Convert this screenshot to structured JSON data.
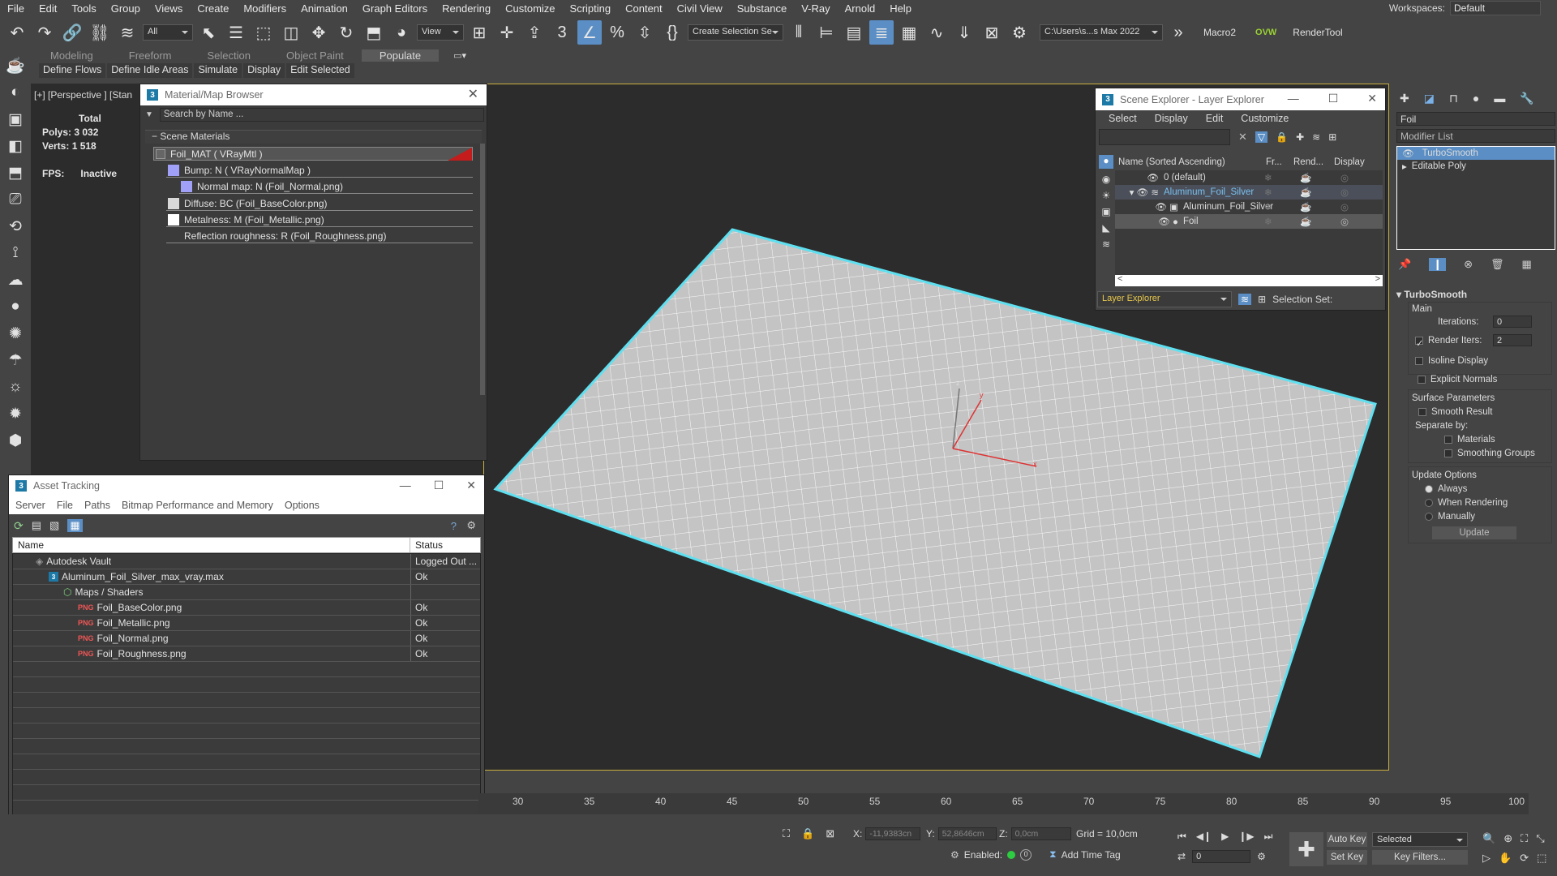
{
  "menu": [
    "File",
    "Edit",
    "Tools",
    "Group",
    "Views",
    "Create",
    "Modifiers",
    "Animation",
    "Graph Editors",
    "Rendering",
    "Customize",
    "Scripting",
    "Content",
    "Civil View",
    "Substance",
    "V-Ray",
    "Arnold",
    "Help"
  ],
  "workspace": {
    "label": "Workspaces:",
    "value": "Default"
  },
  "toolbar": {
    "filter": "All",
    "refcoord": "View",
    "selection_set": "Create Selection Se",
    "project_path": "C:\\Users\\s...s Max 2022",
    "macro": "Macro2",
    "renderTool": "RenderTool"
  },
  "ribbon": {
    "tabs": [
      "Modeling",
      "Freeform",
      "Selection",
      "Object Paint",
      "Populate"
    ],
    "active": "Populate",
    "subtabs": [
      "Define Flows",
      "Define Idle Areas",
      "Simulate",
      "Display",
      "Edit Selected"
    ]
  },
  "viewport": {
    "label": "[+] [Perspective ] [Stan",
    "stats": {
      "total": "Total",
      "polys_label": "Polys:",
      "polys": "3 032",
      "verts_label": "Verts:",
      "verts": "1 518",
      "fps_label": "FPS:",
      "fps": "Inactive"
    }
  },
  "material_browser": {
    "title": "Material/Map Browser",
    "search_placeholder": "Search by Name ...",
    "group": "Scene Materials",
    "items": [
      {
        "text": "Foil_MAT  ( VRayMtl )",
        "indent": 0
      },
      {
        "text": "Bump: N  ( VRayNormalMap )",
        "indent": 1
      },
      {
        "text": "Normal map: N (Foil_Normal.png)",
        "indent": 2
      },
      {
        "text": "Diffuse: BC (Foil_BaseColor.png)",
        "indent": 1
      },
      {
        "text": "Metalness: M (Foil_Metallic.png)",
        "indent": 1
      },
      {
        "text": "Reflection roughness: R (Foil_Roughness.png)",
        "indent": 1
      }
    ]
  },
  "asset_tracking": {
    "title": "Asset Tracking",
    "menu": [
      "Server",
      "File",
      "Paths",
      "Bitmap Performance and Memory",
      "Options"
    ],
    "columns": [
      "Name",
      "Status"
    ],
    "rows": [
      {
        "name": "Autodesk Vault",
        "status": "Logged Out ...",
        "indent": 0
      },
      {
        "name": "Aluminum_Foil_Silver_max_vray.max",
        "status": "Ok",
        "indent": 1
      },
      {
        "name": "Maps / Shaders",
        "status": "",
        "indent": 2
      },
      {
        "name": "Foil_BaseColor.png",
        "status": "Ok",
        "indent": 3
      },
      {
        "name": "Foil_Metallic.png",
        "status": "Ok",
        "indent": 3
      },
      {
        "name": "Foil_Normal.png",
        "status": "Ok",
        "indent": 3
      },
      {
        "name": "Foil_Roughness.png",
        "status": "Ok",
        "indent": 3
      }
    ]
  },
  "scene_explorer": {
    "title": "Scene Explorer - Layer Explorer",
    "menu": [
      "Select",
      "Display",
      "Edit",
      "Customize"
    ],
    "columns": [
      "Name (Sorted Ascending)",
      "Fr...",
      "Rend...",
      "Display"
    ],
    "rows": [
      {
        "name": "0 (default)",
        "indent": 0
      },
      {
        "name": "Aluminum_Foil_Silver",
        "indent": 0
      },
      {
        "name": "Aluminum_Foil_Silver",
        "indent": 1
      },
      {
        "name": "Foil",
        "indent": 1
      }
    ],
    "footer_dropdown": "Layer Explorer",
    "selection_set_label": "Selection Set:"
  },
  "modifier_panel": {
    "object_name": "Foil",
    "modifier_list": "Modifier List",
    "stack": [
      "TurboSmooth",
      "Editable Poly"
    ],
    "rollout": "TurboSmooth",
    "main": "Main",
    "iterations_label": "Iterations:",
    "iterations": "0",
    "render_iters_label": "Render Iters:",
    "render_iters": "2",
    "isoline": "Isoline Display",
    "explicit_normals": "Explicit Normals",
    "surface_params": "Surface Parameters",
    "smooth_result": "Smooth Result",
    "separate_by": "Separate by:",
    "materials": "Materials",
    "smoothing_groups": "Smoothing Groups",
    "update_options": "Update Options",
    "always": "Always",
    "when_rendering": "When Rendering",
    "manually": "Manually",
    "update": "Update"
  },
  "timeline": {
    "ticks": [
      "30",
      "35",
      "40",
      "45",
      "50",
      "55",
      "60",
      "65",
      "70",
      "75",
      "80",
      "85",
      "90",
      "95",
      "100"
    ]
  },
  "status": {
    "x_label": "X:",
    "x": "-11,9383cn",
    "y_label": "Y:",
    "y": "52,8646cm",
    "z_label": "Z:",
    "z": "0,0cm",
    "grid": "Grid = 10,0cm",
    "enabled": "Enabled:",
    "add_time_tag": "Add Time Tag",
    "auto_key": "Auto Key",
    "set_key": "Set Key",
    "selected": "Selected",
    "key_filters": "Key Filters...",
    "frame": "0"
  },
  "colors": {
    "accent": "#5a8ec4",
    "highlight": "#c9b040",
    "selection_wire": "#5fe0f0",
    "material_red": "#c41c1c"
  }
}
